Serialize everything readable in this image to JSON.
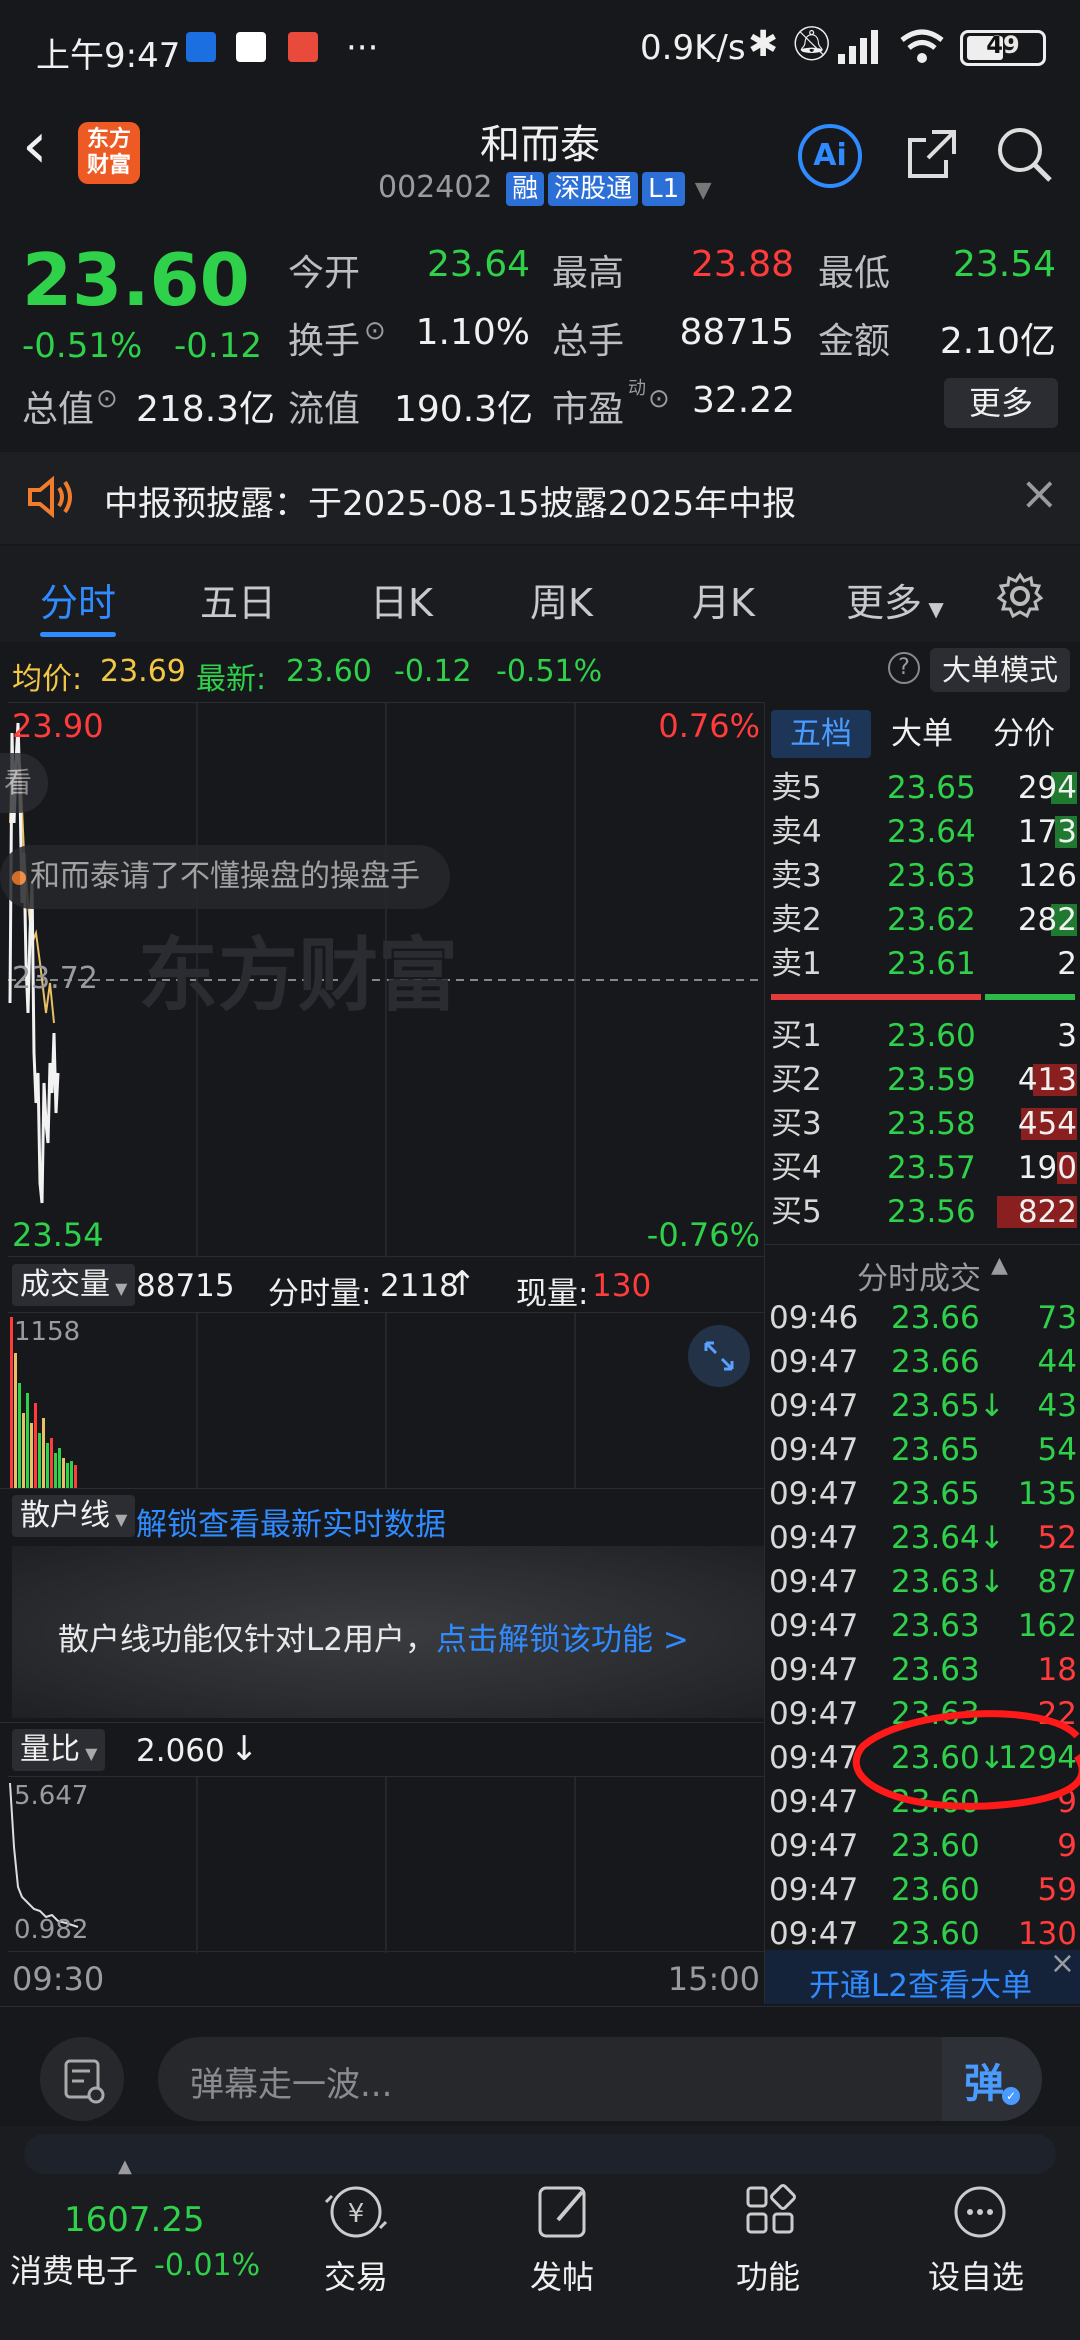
{
  "status": {
    "time": "上午9:47",
    "icons_left": [
      "app-icon-1",
      "app-icon-2",
      "app-icon-3"
    ],
    "more": "···",
    "speed": "0.9K/s",
    "battery": "49"
  },
  "header": {
    "logo_line1": "东方",
    "logo_line2": "财富",
    "stock_name": "和而泰",
    "stock_code": "002402",
    "tags": [
      "融",
      "深股通",
      "L1"
    ],
    "ai_label": "Ai"
  },
  "quote": {
    "price": "23.60",
    "change_pct": "-0.51%",
    "change_abs": "-0.12",
    "open_label": "今开",
    "open": "23.64",
    "high_label": "最高",
    "high": "23.88",
    "low_label": "最低",
    "low": "23.54",
    "turnover_label": "换手",
    "turnover": "1.10%",
    "volume_label": "总手",
    "volume": "88715",
    "amount_label": "金额",
    "amount": "2.10亿",
    "mktcap_label": "总值",
    "mktcap": "218.3亿",
    "float_label": "流值",
    "float": "190.3亿",
    "pe_label": "市盈",
    "pe_sup": "动",
    "pe": "32.22",
    "more_btn": "更多"
  },
  "notice": {
    "text": "中报预披露：于2025-08-15披露2025年中报"
  },
  "tabs": [
    "分时",
    "五日",
    "日K",
    "周K",
    "月K",
    "更多"
  ],
  "avgline": {
    "avg_label": "均价:",
    "avg": "23.69",
    "latest_label": "最新:",
    "latest": "23.60",
    "chg": "-0.12",
    "pct": "-0.51%",
    "mode_btn": "大单模式"
  },
  "chart": {
    "top_price": "23.90",
    "top_pct": "0.76%",
    "bottom_price": "23.54",
    "bottom_pct": "-0.76%",
    "mid_price": "23.72",
    "watermark": "东方财富",
    "danmu_text": "和而泰请了不懂操盘的操盘手",
    "danmu_left": "看"
  },
  "volume": {
    "label": "成交量",
    "total": "88715",
    "fenshi_label": "分时量:",
    "fenshi": "2118",
    "now_label": "现量:",
    "now": "130",
    "max": "1158"
  },
  "sanhu": {
    "label": "散户线",
    "unlock_link": "解锁查看最新实时数据",
    "info": "散户线功能仅针对L2用户，",
    "info_link": "点击解锁该功能 >"
  },
  "liangbi": {
    "label": "量比",
    "value": "2.060",
    "max": "5.647",
    "min": "0.982"
  },
  "time_axis": {
    "start": "09:30",
    "end": "15:00"
  },
  "orderbook": {
    "tabs": [
      "五档",
      "大单",
      "分价"
    ],
    "sells": [
      {
        "label": "卖5",
        "price": "23.65",
        "vol": "294"
      },
      {
        "label": "卖4",
        "price": "23.64",
        "vol": "173"
      },
      {
        "label": "卖3",
        "price": "23.63",
        "vol": "126"
      },
      {
        "label": "卖2",
        "price": "23.62",
        "vol": "282"
      },
      {
        "label": "卖1",
        "price": "23.61",
        "vol": "2"
      }
    ],
    "buys": [
      {
        "label": "买1",
        "price": "23.60",
        "vol": "3"
      },
      {
        "label": "买2",
        "price": "23.59",
        "vol": "413"
      },
      {
        "label": "买3",
        "price": "23.58",
        "vol": "454"
      },
      {
        "label": "买4",
        "price": "23.57",
        "vol": "190"
      },
      {
        "label": "买5",
        "price": "23.56",
        "vol": "822"
      }
    ]
  },
  "trades": {
    "title": "分时成交",
    "rows": [
      {
        "time": "09:46",
        "price": "23.66",
        "vol": "73",
        "dir": "",
        "vcolor": "green"
      },
      {
        "time": "09:47",
        "price": "23.66",
        "vol": "44",
        "dir": "",
        "vcolor": "green"
      },
      {
        "time": "09:47",
        "price": "23.65",
        "vol": "43",
        "dir": "↓",
        "vcolor": "green"
      },
      {
        "time": "09:47",
        "price": "23.65",
        "vol": "54",
        "dir": "",
        "vcolor": "green"
      },
      {
        "time": "09:47",
        "price": "23.65",
        "vol": "135",
        "dir": "",
        "vcolor": "green"
      },
      {
        "time": "09:47",
        "price": "23.64",
        "vol": "52",
        "dir": "↓",
        "vcolor": "red"
      },
      {
        "time": "09:47",
        "price": "23.63",
        "vol": "87",
        "dir": "↓",
        "vcolor": "green"
      },
      {
        "time": "09:47",
        "price": "23.63",
        "vol": "162",
        "dir": "",
        "vcolor": "green"
      },
      {
        "time": "09:47",
        "price": "23.63",
        "vol": "18",
        "dir": "",
        "vcolor": "red"
      },
      {
        "time": "09:47",
        "price": "23.63",
        "vol": "22",
        "dir": "",
        "vcolor": "red"
      },
      {
        "time": "09:47",
        "price": "23.60",
        "vol": "1294",
        "dir": "↓",
        "vcolor": "green"
      },
      {
        "time": "09:47",
        "price": "23.60",
        "vol": "9",
        "dir": "",
        "vcolor": "red"
      },
      {
        "time": "09:47",
        "price": "23.60",
        "vol": "9",
        "dir": "",
        "vcolor": "red"
      },
      {
        "time": "09:47",
        "price": "23.60",
        "vol": "59",
        "dir": "",
        "vcolor": "red"
      },
      {
        "time": "09:47",
        "price": "23.60",
        "vol": "130",
        "dir": "",
        "vcolor": "red"
      }
    ],
    "l2_link": "开通L2查看大单"
  },
  "input": {
    "placeholder": "弹幕走一波...",
    "send": "弹"
  },
  "bottom_nav": {
    "index_value": "1607.25",
    "index_name": "消费电子",
    "index_pct": "-0.01%",
    "items": [
      "交易",
      "发帖",
      "功能",
      "设自选"
    ]
  },
  "colors": {
    "up": "#ff3b3b",
    "down": "#2fd14a",
    "accent": "#2f8bff",
    "bg": "#17181b"
  }
}
